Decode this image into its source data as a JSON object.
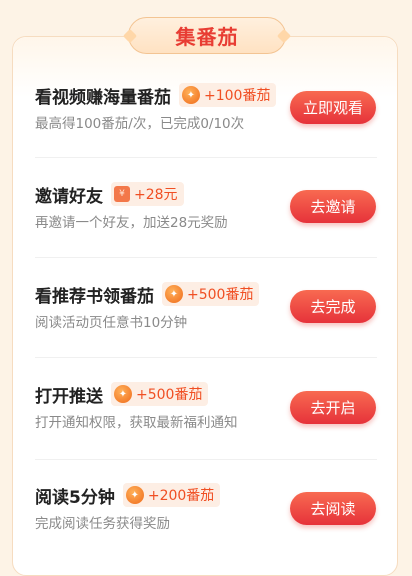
{
  "header": {
    "title": "集番茄"
  },
  "tasks": [
    {
      "title": "看视频赚海量番茄",
      "reward": "+100番茄",
      "reward_icon": "tomato-coin-icon",
      "subtitle": "最高得100番茄/次，已完成0/10次",
      "button": "立即观看"
    },
    {
      "title": "邀请好友",
      "reward": "+28元",
      "reward_icon": "cash-icon",
      "subtitle": "再邀请一个好友，加送28元奖励",
      "button": "去邀请"
    },
    {
      "title": "看推荐书领番茄",
      "reward": "+500番茄",
      "reward_icon": "tomato-coin-icon",
      "subtitle": "阅读活动页任意书10分钟",
      "button": "去完成"
    },
    {
      "title": "打开推送",
      "reward": "+500番茄",
      "reward_icon": "tomato-coin-icon",
      "subtitle": "打开通知权限，获取最新福利通知",
      "button": "去开启"
    },
    {
      "title": "阅读5分钟",
      "reward": "+200番茄",
      "reward_icon": "tomato-coin-icon",
      "subtitle": "完成阅读任务获得奖励",
      "button": "去阅读"
    }
  ],
  "colors": {
    "accent": "#e83d33",
    "reward_text": "#f04f23",
    "reward_bg": "#fdeee4",
    "page_bg": "#fdf3e6"
  }
}
